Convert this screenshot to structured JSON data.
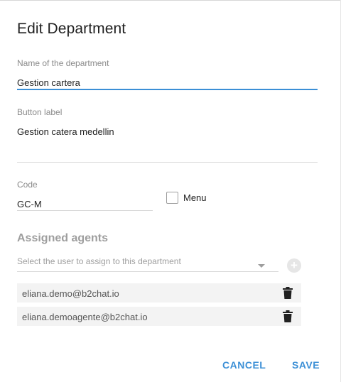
{
  "dialog": {
    "title": "Edit Department",
    "name_field": {
      "label": "Name of the department",
      "value": "Gestion cartera"
    },
    "button_label_field": {
      "label": "Button label",
      "value": "Gestion catera  medellin"
    },
    "code_field": {
      "label": "Code",
      "value": "GC-M"
    },
    "menu_checkbox": {
      "label": "Menu",
      "checked": false
    },
    "assigned_agents": {
      "title": "Assigned agents",
      "select_placeholder": "Select the user to assign to this department",
      "agents": [
        {
          "email": "eliana.demo@b2chat.io"
        },
        {
          "email": "eliana.demoagente@b2chat.io"
        }
      ]
    },
    "actions": {
      "cancel_label": "CANCEL",
      "save_label": "SAVE"
    }
  },
  "colors": {
    "accent": "#3b8fd6",
    "muted": "#9e9e9e"
  }
}
